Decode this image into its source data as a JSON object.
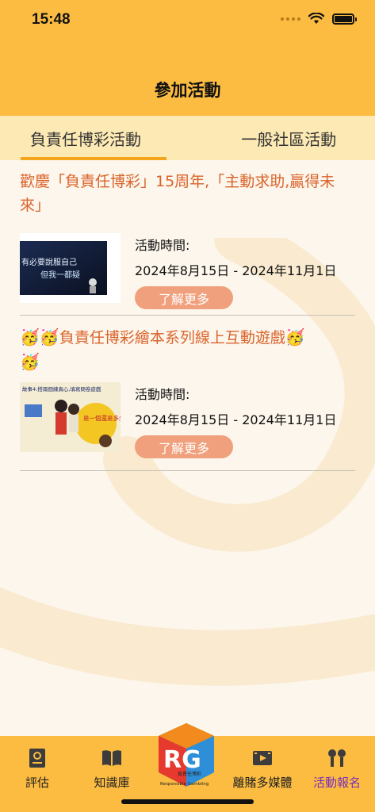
{
  "status_bar": {
    "time": "15:48"
  },
  "header": {
    "title": "參加活動"
  },
  "tabs": [
    {
      "label": "負責任博彩活動",
      "active": true
    },
    {
      "label": "一般社區活動",
      "active": false
    }
  ],
  "events": [
    {
      "title": "歡慶「負責任博彩」15周年,「主動求助,贏得未來」",
      "time_label": "活動時間:",
      "dates": "2024年8月15日 - 2024年11月1日",
      "button_label": "了解更多",
      "thumb_text": [
        "有必要說服自己",
        "但我一都疑"
      ]
    },
    {
      "title_prefix_emoji": "🥳🥳",
      "title": "負責任博彩繪本系列線上互動遊戲",
      "title_suffix_emoji": "🥳",
      "title_line2_emoji": "🥳",
      "time_label": "活動時間:",
      "dates": "2024年8月15日 - 2024年11月1日",
      "button_label": "了解更多",
      "thumb_text": [
        "故事4:搭兩個練真心,填寫問卷遊戲",
        "是一個還是多少"
      ]
    }
  ],
  "bottom_nav": {
    "items": [
      {
        "label": "評估",
        "icon": "assessment-icon"
      },
      {
        "label": "知識庫",
        "icon": "book-icon"
      },
      {
        "label": "離賭多媒體",
        "icon": "video-icon"
      },
      {
        "label": "活動報名",
        "icon": "activity-icon",
        "active": true
      }
    ],
    "logo_text": "Responsible Gambling",
    "logo_letters": "RG",
    "logo_cn": "負責任博彩"
  },
  "colors": {
    "header": "#fcbc42",
    "tabs_bg": "#fde9b4",
    "accent_text": "#d9632a",
    "button": "#f0a07c",
    "active_nav": "#7b2fb5"
  }
}
